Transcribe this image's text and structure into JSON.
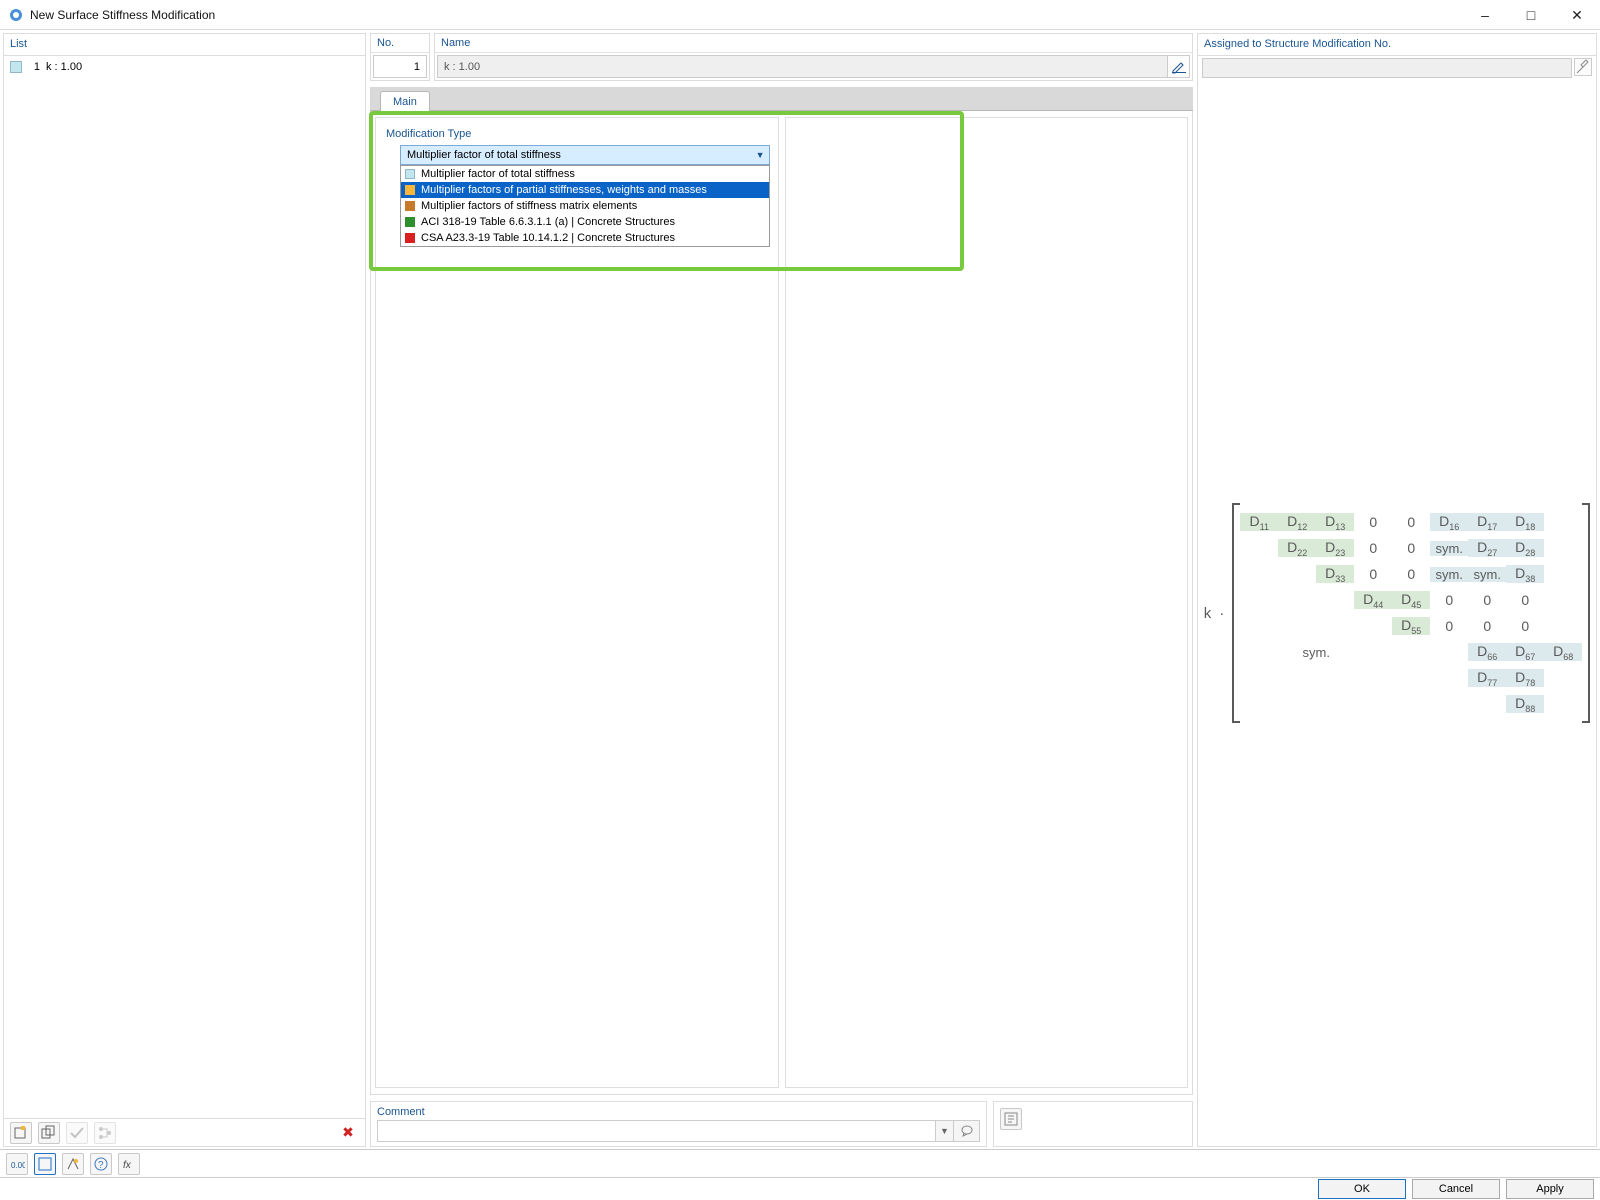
{
  "window": {
    "title": "New Surface Stiffness Modification"
  },
  "list": {
    "header": "List",
    "rows": [
      {
        "index": "1",
        "text": "k : 1.00"
      }
    ]
  },
  "no": {
    "label": "No.",
    "value": "1"
  },
  "name": {
    "label": "Name",
    "value": "k : 1.00"
  },
  "assigned": {
    "label": "Assigned to Structure Modification No.",
    "value": ""
  },
  "tabs": {
    "main": "Main"
  },
  "modtype": {
    "section": "Modification Type",
    "selected": "Multiplier factor of total stiffness",
    "options": [
      {
        "color": "#c3e5ee",
        "label": "Multiplier factor of total stiffness"
      },
      {
        "color": "#f7b53a",
        "label": "Multiplier factors of partial stiffnesses, weights and masses"
      },
      {
        "color": "#c77a2a",
        "label": "Multiplier factors of stiffness matrix elements"
      },
      {
        "color": "#2f8f2f",
        "label": "ACI 318-19 Table 6.6.3.1.1 (a) | Concrete Structures"
      },
      {
        "color": "#d82020",
        "label": "CSA A23.3-19 Table 10.14.1.2 | Concrete Structures"
      }
    ]
  },
  "comment": {
    "label": "Comment"
  },
  "matrix": {
    "prefix": "k",
    "dot": "·",
    "sym": "sym.",
    "rows": [
      [
        "D11",
        "D12",
        "D13",
        "0",
        "0",
        "D16",
        "D17",
        "D18"
      ],
      [
        "",
        "D22",
        "D23",
        "0",
        "0",
        "sym.",
        "D27",
        "D28"
      ],
      [
        "",
        "",
        "D33",
        "0",
        "0",
        "sym.",
        "sym.",
        "D38"
      ],
      [
        "",
        "",
        "",
        "D44",
        "D45",
        "0",
        "0",
        "0"
      ],
      [
        "",
        "",
        "",
        "",
        "D55",
        "0",
        "0",
        "0"
      ],
      [
        "",
        "",
        "",
        "",
        "",
        "D66",
        "D67",
        "D68"
      ],
      [
        "",
        "",
        "",
        "",
        "",
        "",
        "D77",
        "D78"
      ],
      [
        "",
        "",
        "",
        "",
        "",
        "",
        "",
        "D88"
      ]
    ]
  },
  "buttons": {
    "ok": "OK",
    "cancel": "Cancel",
    "apply": "Apply"
  }
}
